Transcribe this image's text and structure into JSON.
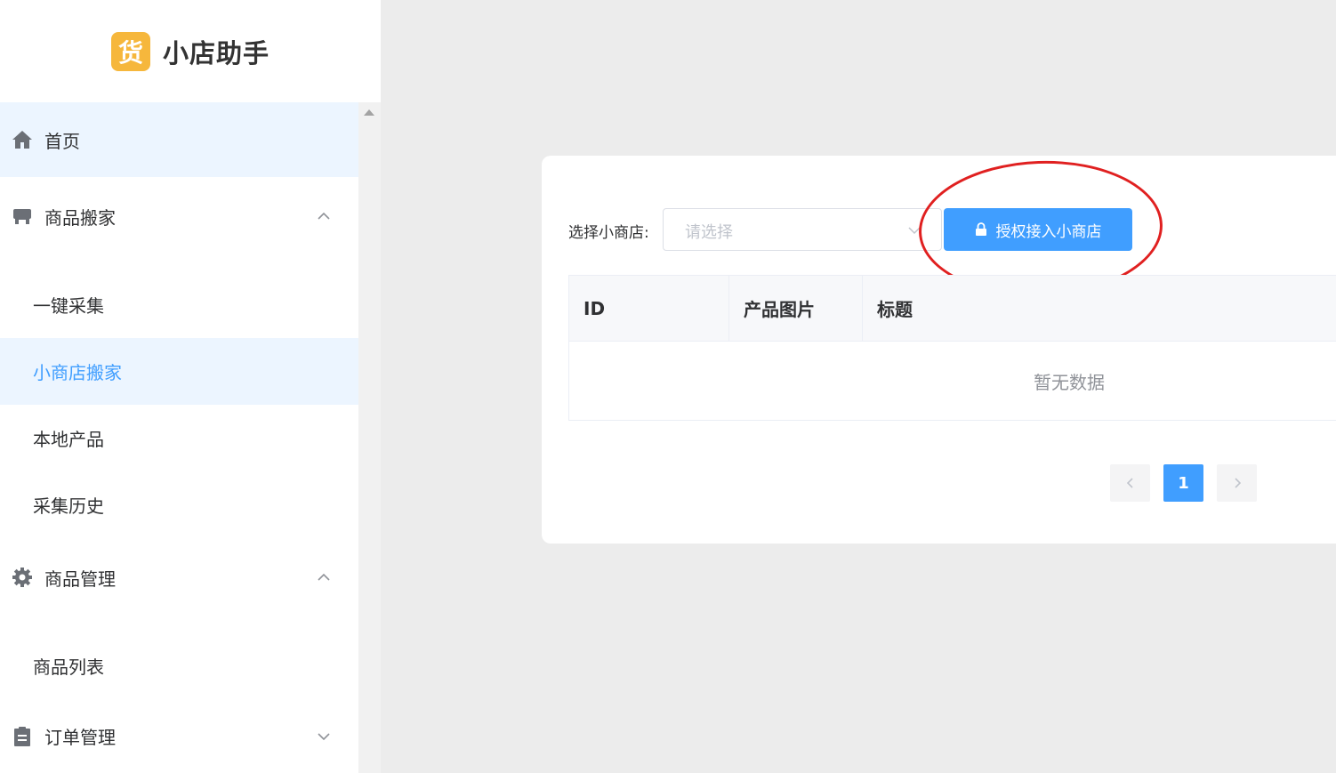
{
  "brand": {
    "logo_char": "货",
    "name": "小店助手",
    "accent": "#f6b73c"
  },
  "sidebar": {
    "items": [
      {
        "label": "首页",
        "icon": "home-icon",
        "type": "top"
      },
      {
        "label": "商品搬家",
        "icon": "store-icon",
        "type": "group",
        "expanded": true
      },
      {
        "label": "一键采集",
        "type": "sub"
      },
      {
        "label": "小商店搬家",
        "type": "sub",
        "active": true
      },
      {
        "label": "本地产品",
        "type": "sub"
      },
      {
        "label": "采集历史",
        "type": "sub"
      },
      {
        "label": "商品管理",
        "icon": "gear-icon",
        "type": "group",
        "expanded": true
      },
      {
        "label": "商品列表",
        "type": "sub"
      },
      {
        "label": "订单管理",
        "icon": "clipboard-icon",
        "type": "group",
        "expanded": false
      }
    ]
  },
  "filter": {
    "label": "选择小商店:",
    "select_placeholder": "请选择",
    "auth_button": "授权接入小商店"
  },
  "table": {
    "columns": [
      "ID",
      "产品图片",
      "标题"
    ],
    "empty_text": "暂无数据"
  },
  "pagination": {
    "current_page": "1"
  },
  "colors": {
    "primary": "#409eff",
    "highlight": "#e02020",
    "active_bg": "#ecf5ff"
  }
}
